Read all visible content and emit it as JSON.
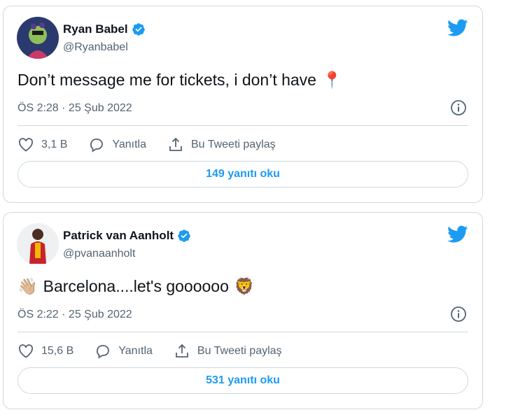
{
  "tweets": [
    {
      "name": "Ryan Babel",
      "handle": "@Ryanbabel",
      "text": "Don’t message me for tickets, i don’t have",
      "emoji_after": "📍",
      "timestamp": "ÖS 2:28 · 25 Şub 2022",
      "like_count": "3,1 B",
      "reply_label": "Yanıtla",
      "share_label": "Bu Tweeti paylaş",
      "read_replies_label": "149 yanıtı oku"
    },
    {
      "name": "Patrick van Aanholt",
      "handle": "@pvanaanholt",
      "emoji_before": "👋🏼",
      "text": "Barcelona....let's goooooo",
      "emoji_after": "🦁",
      "timestamp": "ÖS 2:22 · 25 Şub 2022",
      "like_count": "15,6 B",
      "reply_label": "Yanıtla",
      "share_label": "Bu Tweeti paylaş",
      "read_replies_label": "531 yanıtı oku"
    }
  ],
  "colors": {
    "brand": "#1d9bf0",
    "text": "#0f1419",
    "secondary": "#536471",
    "border": "#cfd9de"
  },
  "icons": [
    "verified-badge-icon",
    "twitter-bird-icon",
    "info-icon",
    "heart-icon",
    "reply-bubble-icon",
    "share-icon"
  ]
}
